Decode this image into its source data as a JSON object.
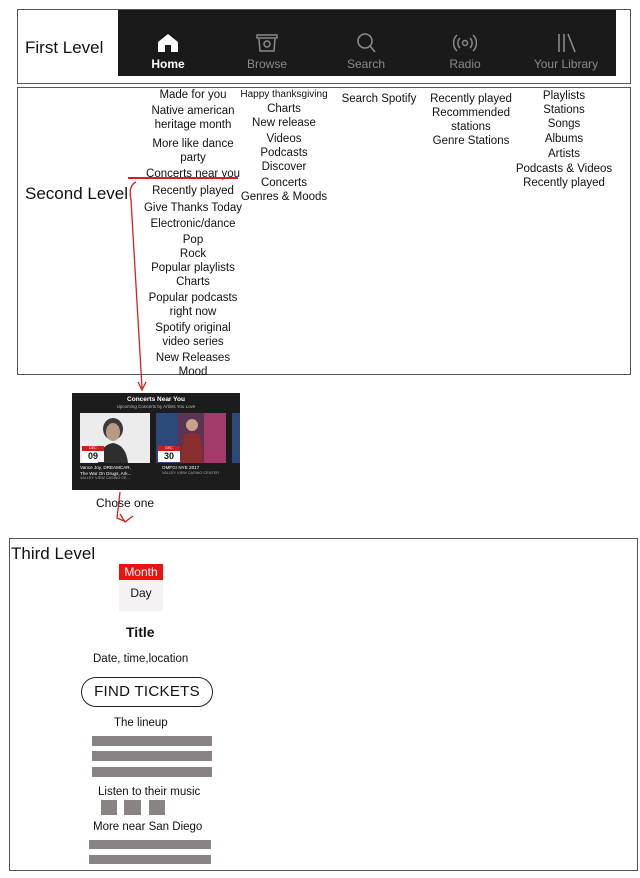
{
  "levels": {
    "first": "First Level",
    "second": "Second Level",
    "third": "Third Level"
  },
  "tabs": [
    {
      "label": "Home",
      "icon": "home-icon",
      "active": true
    },
    {
      "label": "Browse",
      "icon": "browse-icon",
      "active": false
    },
    {
      "label": "Search",
      "icon": "search-icon",
      "active": false
    },
    {
      "label": "Radio",
      "icon": "radio-icon",
      "active": false
    },
    {
      "label": "Your Library",
      "icon": "library-icon",
      "active": false
    }
  ],
  "second": {
    "home": [
      "Made for you",
      "Native american",
      "heritage month",
      "More like dance",
      "party",
      "Concerts near you",
      "Recently played",
      "Give Thanks Today",
      "Electronic/dance",
      "Pop",
      "Rock",
      "Popular playlists",
      "Charts",
      "Popular podcasts",
      "right now",
      "Spotify original",
      "video series",
      "New Releases",
      "Mood"
    ],
    "browse": [
      "Happy thanksgiving",
      "Charts",
      "New release",
      "Videos",
      "Podcasts",
      "Discover",
      "Concerts",
      "Genres & Moods"
    ],
    "search": [
      "Search Spotify"
    ],
    "radio": [
      "Recently played",
      "Recommended",
      "stations",
      "Genre Stations"
    ],
    "library": [
      "Playlists",
      "Stations",
      "Songs",
      "Albums",
      "Artists",
      "Podcasts & Videos",
      "Recently played"
    ]
  },
  "card": {
    "title": "Concerts Near You",
    "subtitle": "Upcoming Concerts by Artists You Love",
    "events": [
      {
        "month": "DEC",
        "day": "09",
        "name": "Vance Joy, DREAMCAR,",
        "name2": "The War On Drugs, Ark...",
        "venue": "VALLEY VIEW CASINO CE..."
      },
      {
        "month": "DEC",
        "day": "30",
        "name": "OMFG! NYE 2017",
        "name2": "",
        "venue": "VALLEY VIEW CASINO CENTER"
      }
    ],
    "caption": "Chose one"
  },
  "third": {
    "month": "Month",
    "day": "Day",
    "title": "Title",
    "details": "Date, time,location",
    "button": "FIND TICKETS",
    "lineup": "The lineup",
    "listen": "Listen to their music",
    "more": "More near San Diego"
  },
  "colors": {
    "accent_red": "#d62020",
    "tab_bar": "#1a1a1a",
    "placeholder_gray": "#8a8384"
  }
}
